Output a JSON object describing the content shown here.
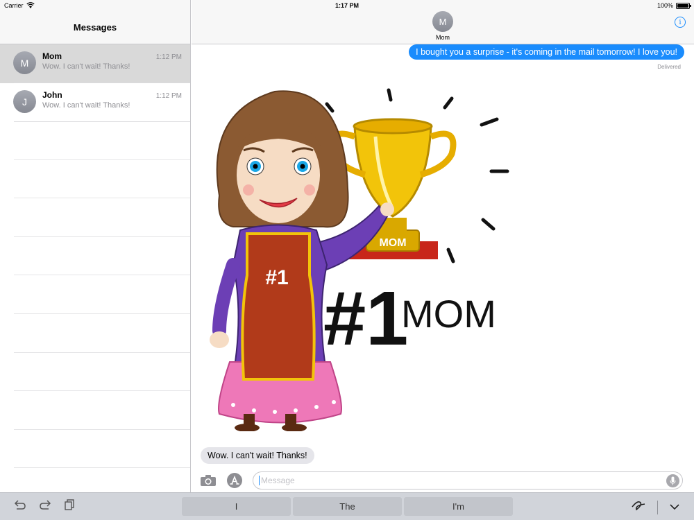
{
  "status_bar": {
    "carrier": "Carrier",
    "time": "1:17 PM",
    "battery": "100%",
    "battery_level": 1.0
  },
  "sidebar": {
    "title": "Messages",
    "conversations": [
      {
        "initial": "M",
        "name": "Mom",
        "time": "1:12 PM",
        "preview": "Wow. I can't wait! Thanks!",
        "selected": true
      },
      {
        "initial": "J",
        "name": "John",
        "time": "1:12 PM",
        "preview": "Wow. I can't wait! Thanks!",
        "selected": false
      }
    ]
  },
  "chat": {
    "contact_initial": "M",
    "contact_name": "Mom",
    "messages": [
      {
        "direction": "outgoing",
        "text": "I bought you a surprise - it's coming in the mail tomorrow! I love you!",
        "status": "Delivered"
      },
      {
        "direction": "outgoing",
        "type": "sticker",
        "sticker_text": [
          "#1",
          "MOM",
          "#1 MOM"
        ]
      },
      {
        "direction": "incoming",
        "text": "Wow. I can't wait! Thanks!"
      }
    ],
    "input_placeholder": "Message"
  },
  "keyboard_bar": {
    "suggestions": [
      "I",
      "The",
      "I'm"
    ]
  },
  "icons": [
    "wifi-icon",
    "battery-icon",
    "info-icon",
    "camera-icon",
    "app-store-icon",
    "mic-icon",
    "undo-icon",
    "redo-icon",
    "paste-icon",
    "handwriting-icon",
    "chevron-down-icon"
  ],
  "colors": {
    "accent": "#1a8cfd",
    "incoming_bubble": "#e5e5ea",
    "selected_row": "#d9d9d9"
  }
}
